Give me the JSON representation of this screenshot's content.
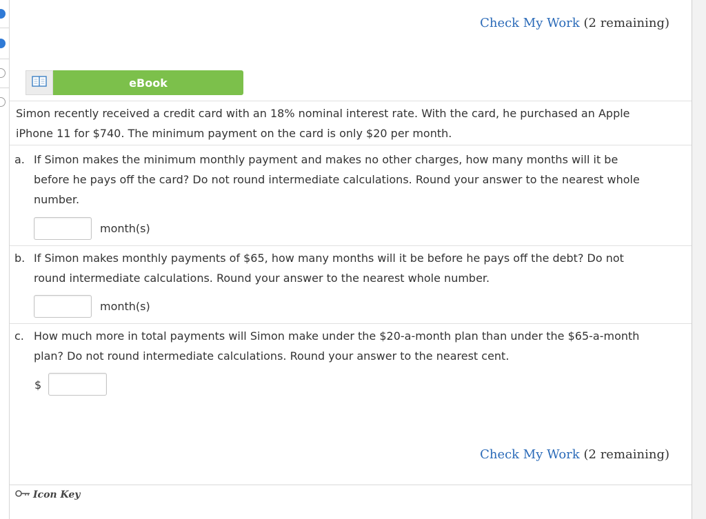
{
  "check_my_work": {
    "link": "Check My Work",
    "remaining": "(2 remaining)"
  },
  "ebook": {
    "label": "eBook",
    "icon": "book-icon"
  },
  "intro": {
    "line1": "Simon recently received a credit card with an 18% nominal interest rate. With the card, he purchased an Apple",
    "line2": "iPhone 11 for $740. The minimum payment on the card is only $20 per month."
  },
  "questions": [
    {
      "letter": "a.",
      "lines": [
        "If Simon makes the minimum monthly payment and makes no other charges, how many months will it be",
        "before he pays off the card? Do not round intermediate calculations. Round your answer to the nearest whole",
        "number."
      ],
      "answer_value": "",
      "unit": "month(s)"
    },
    {
      "letter": "b.",
      "lines": [
        "If Simon makes monthly payments of $65, how many months will it be before he pays off the debt? Do not",
        "round intermediate calculations. Round your answer to the nearest whole number."
      ],
      "answer_value": "",
      "unit": "month(s)"
    },
    {
      "letter": "c.",
      "lines": [
        "How much more in total payments will Simon make under the $20-a-month plan than under the $65-a-month",
        "plan? Do not round intermediate calculations. Round your answer to the nearest cent."
      ],
      "answer_value": "",
      "prefix": "$"
    }
  ],
  "footer": {
    "icon_key_label": "Icon Key",
    "icon": "key-icon"
  },
  "progress_rail": {
    "dots": [
      "filled",
      "filled",
      "empty",
      "empty"
    ]
  },
  "colors": {
    "link": "#2a6ab8",
    "ebook_green": "#7cc04b",
    "progress_blue": "#2f7ad6"
  }
}
